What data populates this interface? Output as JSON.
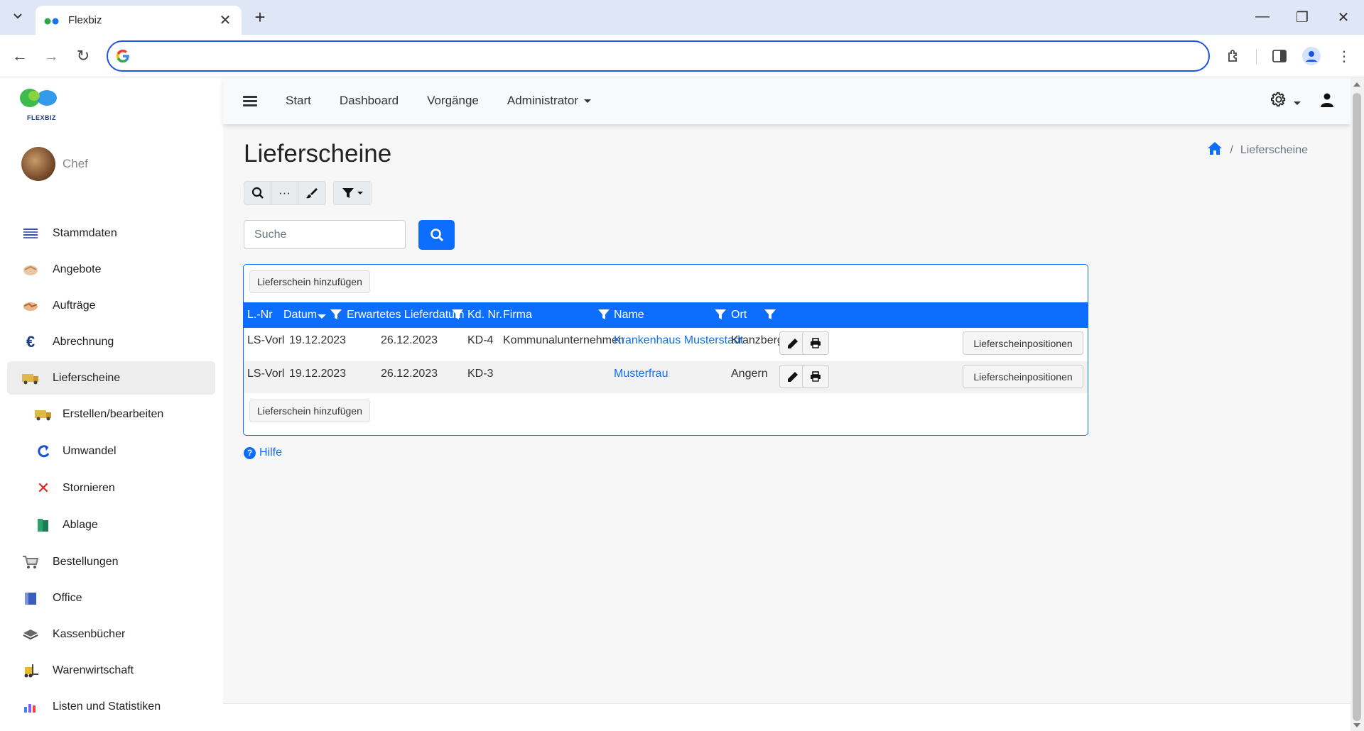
{
  "browser": {
    "tab_title": "Flexbiz",
    "address_value": ""
  },
  "app": {
    "logo_text": "FLEXBIZ",
    "user_name": "Chef",
    "topnav": {
      "start": "Start",
      "dashboard": "Dashboard",
      "vorgaenge": "Vorgänge",
      "administrator": "Administrator"
    }
  },
  "sidebar": {
    "items": [
      {
        "label": "Stammdaten",
        "icon": "list-icon"
      },
      {
        "label": "Angebote",
        "icon": "handshake-icon"
      },
      {
        "label": "Aufträge",
        "icon": "handshake-icon"
      },
      {
        "label": "Abrechnung",
        "icon": "euro-icon"
      },
      {
        "label": "Lieferscheine",
        "icon": "truck-icon"
      },
      {
        "label": "Erstellen/bearbeiten",
        "icon": "truck-icon"
      },
      {
        "label": "Umwandel",
        "icon": "refresh-icon"
      },
      {
        "label": "Stornieren",
        "icon": "cross-icon"
      },
      {
        "label": "Ablage",
        "icon": "binder-icon"
      },
      {
        "label": "Bestellungen",
        "icon": "cart-icon"
      },
      {
        "label": "Office",
        "icon": "folder-icon"
      },
      {
        "label": "Kassenbücher",
        "icon": "register-icon"
      },
      {
        "label": "Warenwirtschaft",
        "icon": "forklift-icon"
      },
      {
        "label": "Listen und Statistiken",
        "icon": "chart-icon"
      }
    ]
  },
  "page": {
    "title": "Lieferscheine",
    "breadcrumb_current": "Lieferscheine",
    "search_placeholder": "Suche",
    "add_button": "Lieferschein hinzufügen",
    "help_label": "Hilfe"
  },
  "table": {
    "columns": {
      "lnr": "L.-Nr",
      "datum": "Datum",
      "erwartet": "Erwartetes Lieferdatum",
      "kdnr": "Kd. Nr.",
      "firma": "Firma",
      "name": "Name",
      "ort": "Ort"
    },
    "rows": [
      {
        "lnr": "LS-Vorl",
        "datum": "19.12.2023",
        "erwartet": "26.12.2023",
        "kdnr": "KD-4",
        "firma": "Kommunalunternehmen",
        "name": "Krankenhaus Musterstadt",
        "ort": "Kranzberg",
        "positions_label": "Lieferscheinpositionen"
      },
      {
        "lnr": "LS-Vorl",
        "datum": "19.12.2023",
        "erwartet": "26.12.2023",
        "kdnr": "KD-3",
        "firma": "",
        "name": "Musterfrau",
        "ort": "Angern",
        "positions_label": "Lieferscheinpositionen"
      }
    ]
  },
  "colors": {
    "primary": "#0d6efd",
    "tabbar": "#dfe6f5",
    "sidebar_active": "#ededed"
  }
}
